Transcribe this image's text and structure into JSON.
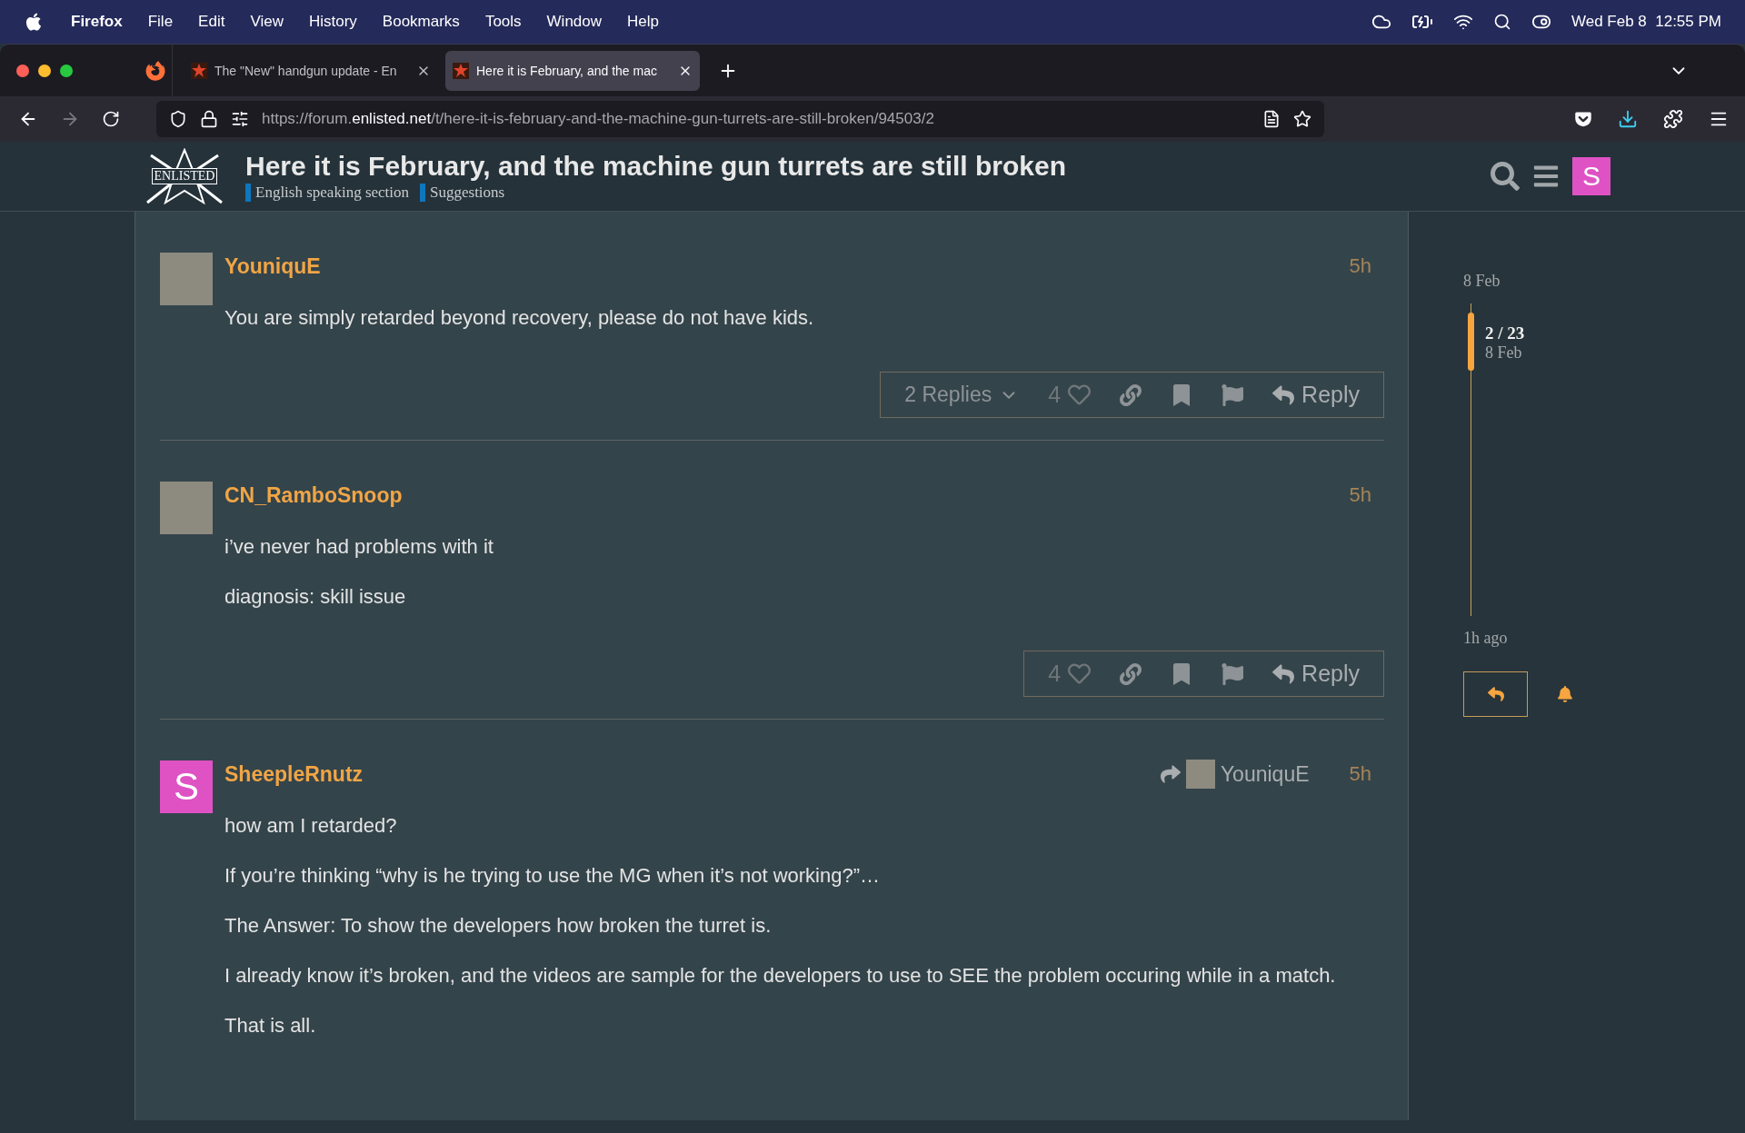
{
  "menubar": {
    "app": "Firefox",
    "menus": [
      "File",
      "Edit",
      "View",
      "History",
      "Bookmarks",
      "Tools",
      "Window",
      "Help"
    ],
    "clock": "Wed Feb 8  12:55 PM"
  },
  "tabs": [
    {
      "title": "The \"New\" handgun update - En",
      "selected": false
    },
    {
      "title": "Here it is February, and the mac",
      "selected": true
    }
  ],
  "url": {
    "before": "https://forum.",
    "domain": "enlisted.net",
    "after": "/t/here-it-is-february-and-the-machine-gun-turrets-are-still-broken/94503/2"
  },
  "header": {
    "logo_text": "ENLISTED",
    "title": "Here it is February, and the machine gun turrets are still broken",
    "categories": [
      {
        "name": "English speaking section",
        "color": "#0e76bd"
      },
      {
        "name": "Suggestions",
        "color": "#0e76bd"
      }
    ],
    "user_letter": "S"
  },
  "posts": [
    {
      "username": "YouniquE",
      "avatar": {
        "kind": "photo"
      },
      "age": "5h",
      "paragraphs": [
        "You are simply retarded beyond recovery, please do not have kids."
      ],
      "actions": {
        "replies": "2 Replies",
        "likes": "4",
        "reply": "Reply"
      }
    },
    {
      "username": "CN_RamboSnoop",
      "avatar": {
        "kind": "photo"
      },
      "age": "5h",
      "paragraphs": [
        "i’ve never had problems with it",
        "diagnosis: skill issue"
      ],
      "actions": {
        "likes": "4",
        "reply": "Reply"
      }
    },
    {
      "username": "SheepleRnutz",
      "avatar": {
        "kind": "letter",
        "letter": "S"
      },
      "age": "5h",
      "reply_to": {
        "username": "YouniquE"
      },
      "paragraphs": [
        "how am I retarded?",
        "If you’re thinking “why is he trying to use the MG when it’s not working?”…",
        "The Answer: To show the developers how broken the turret is.",
        "I already know it’s broken, and the videos are sample for the developers to use to SEE the problem occuring while in a match.",
        "That is all."
      ]
    }
  ],
  "timeline": {
    "start": "8 Feb",
    "position": "2 / 23",
    "position_date": "8 Feb",
    "end": "1h ago"
  }
}
